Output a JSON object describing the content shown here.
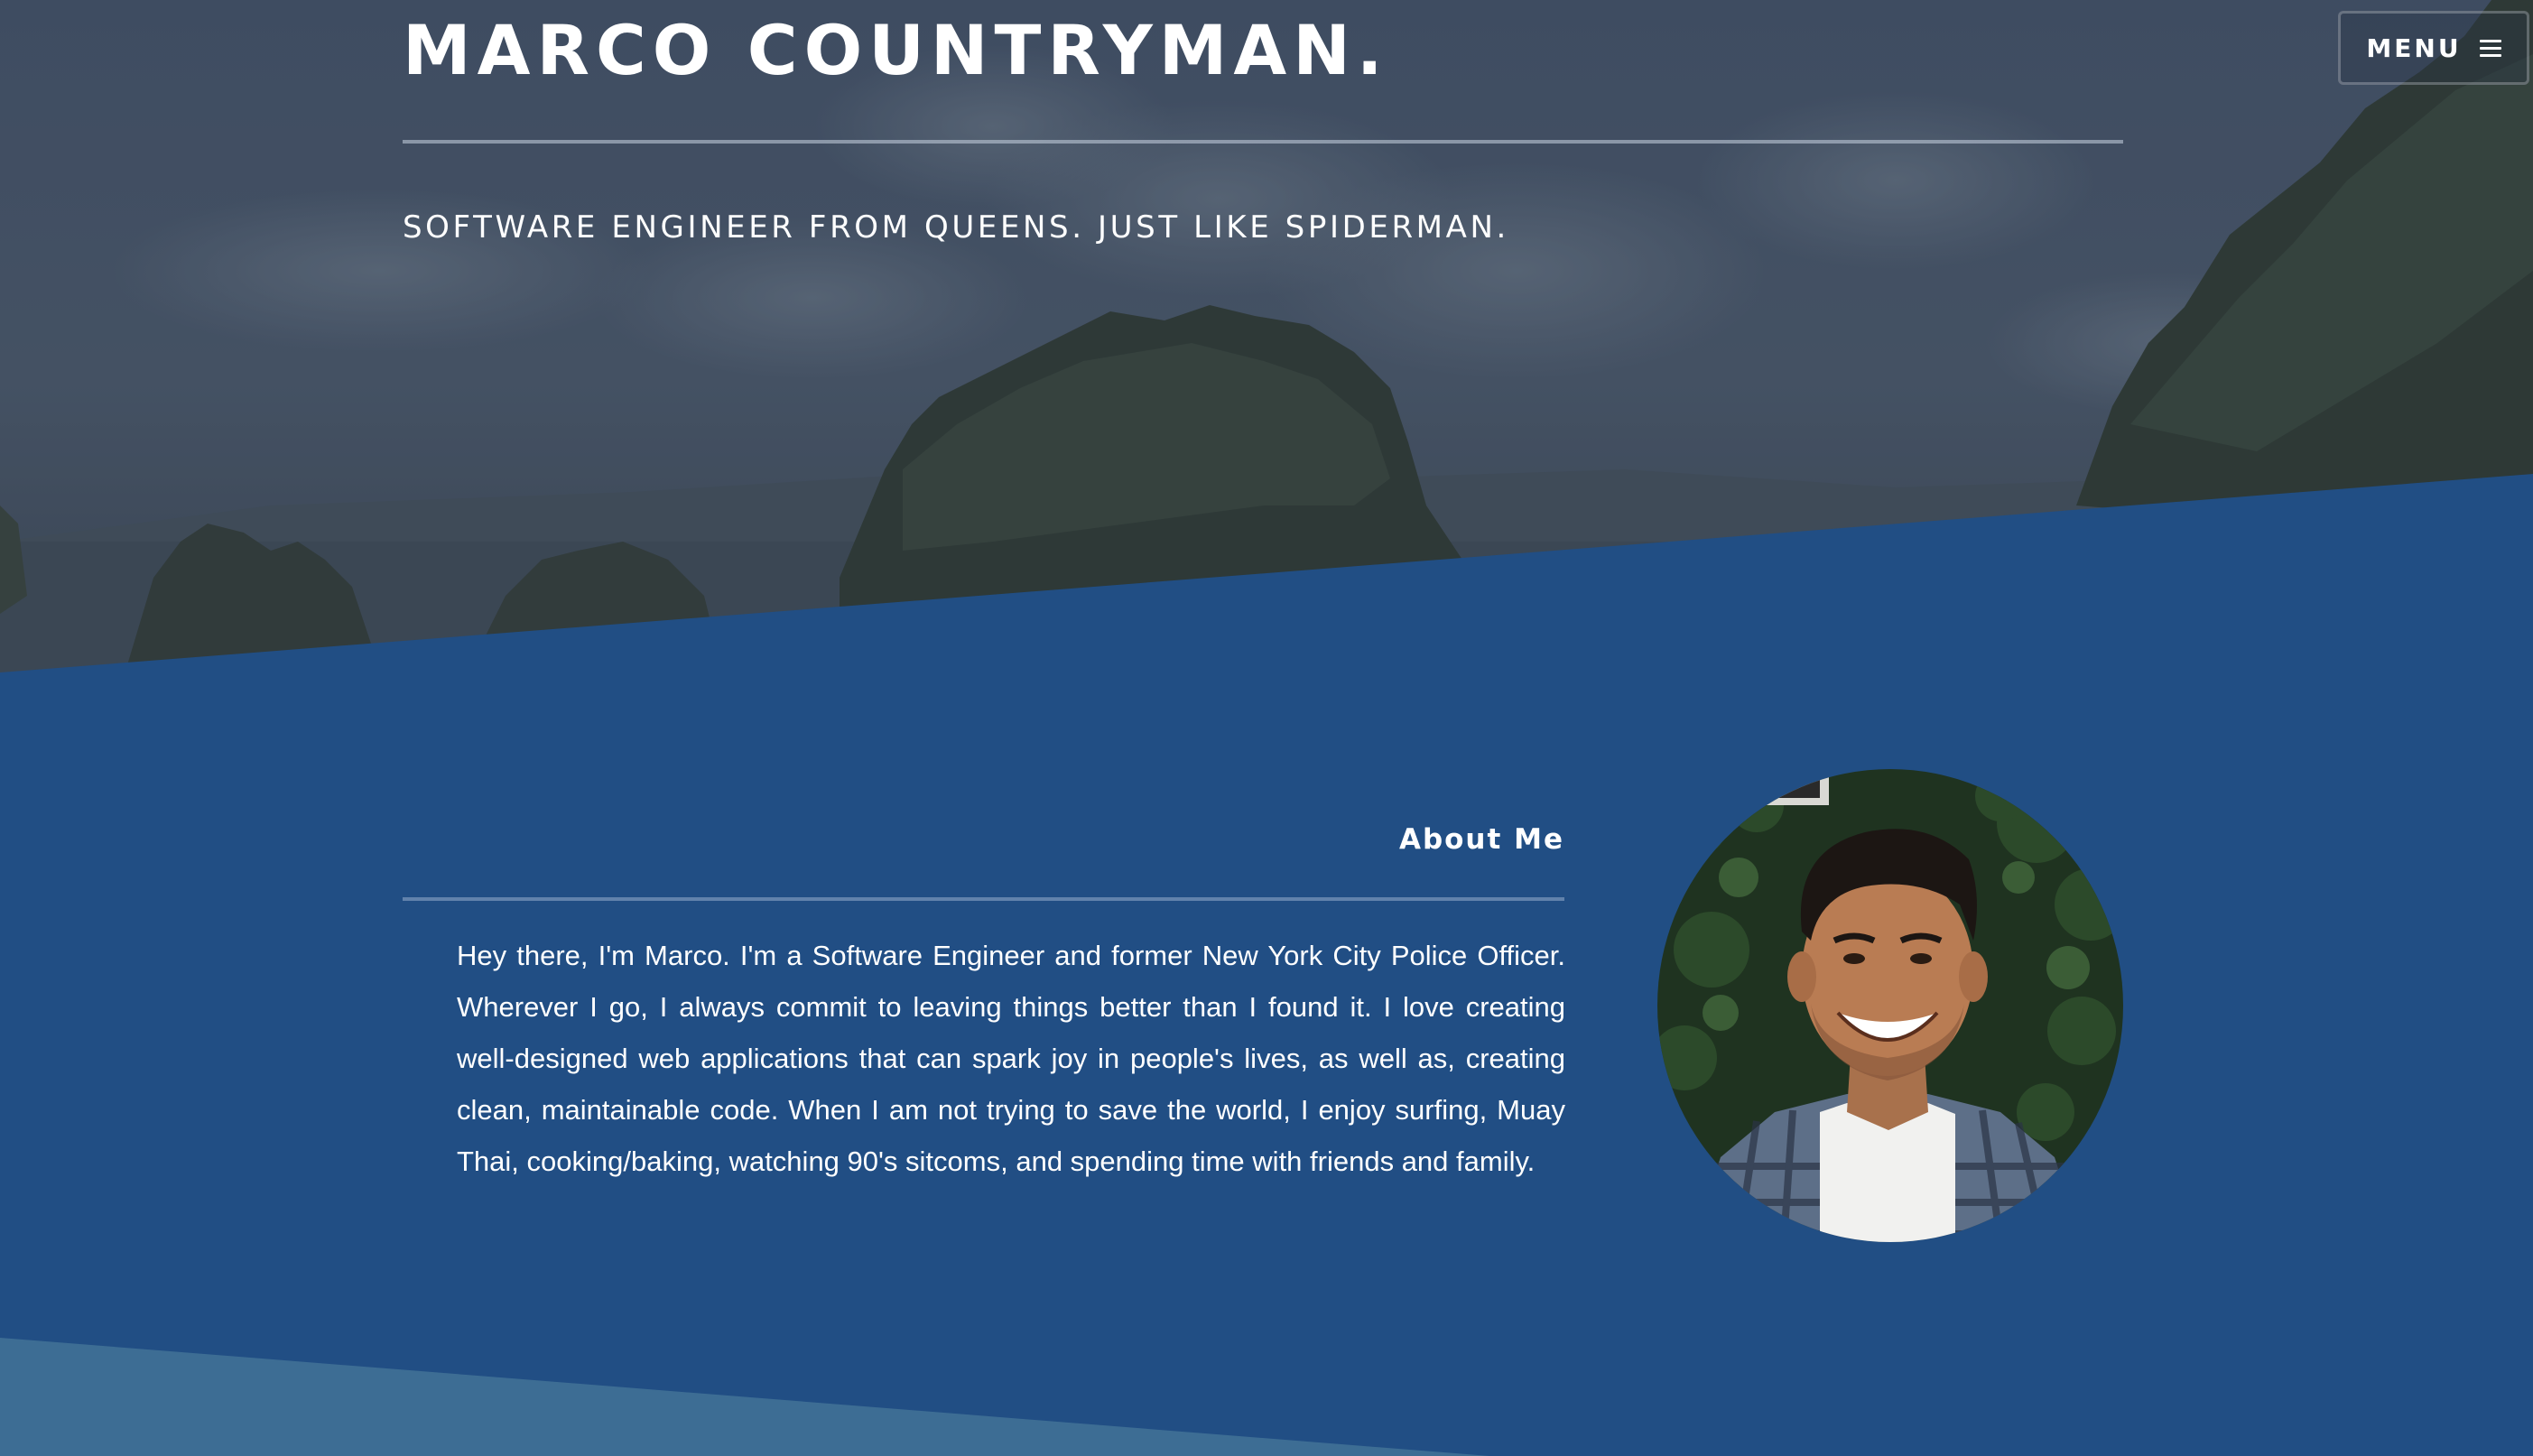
{
  "hero": {
    "title": "MARCO COUNTRYMAN.",
    "subtitle": "SOFTWARE ENGINEER FROM QUEENS. JUST LIKE SPIDERMAN."
  },
  "nav": {
    "menu_label": "MENU",
    "menu_icon": "hamburger-icon"
  },
  "about": {
    "heading": "About Me",
    "body": "Hey there, I'm Marco. I'm a Software Engineer and former New York City Police Officer. Wherever I go, I always commit to leaving things better than I found it. I love creating well-designed web applications that can spark joy in people's lives, as well as, creating clean, maintainable code. When I am not trying to save the world, I enjoy surfing, Muay Thai, cooking/baking, watching 90's sitcoms, and spending time with friends and family."
  },
  "colors": {
    "section_blue": "#214e84",
    "bottom_band_blue": "#3d6d94",
    "hero_overlay": "#3e4c5f"
  }
}
